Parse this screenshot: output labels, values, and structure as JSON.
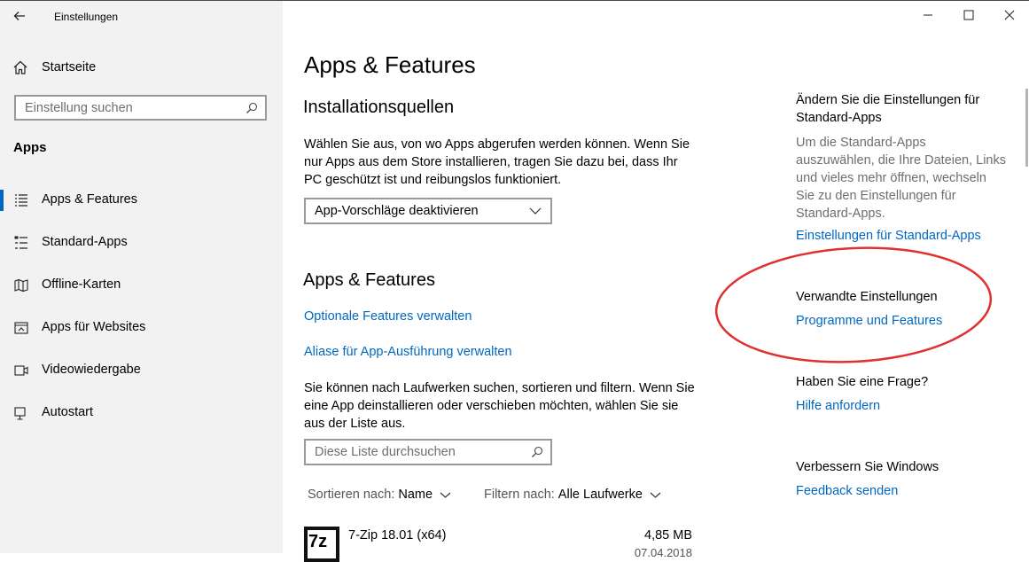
{
  "window": {
    "title": "Einstellungen",
    "back": "back-arrow-icon"
  },
  "sidebar": {
    "home_label": "Startseite",
    "search_placeholder": "Einstellung suchen",
    "section": "Apps",
    "items": [
      {
        "label": "Apps & Features",
        "icon": "apps-features-icon",
        "selected": true
      },
      {
        "label": "Standard-Apps",
        "icon": "default-apps-icon",
        "selected": false
      },
      {
        "label": "Offline-Karten",
        "icon": "offline-maps-icon",
        "selected": false
      },
      {
        "label": "Apps für Websites",
        "icon": "apps-for-websites-icon",
        "selected": false
      },
      {
        "label": "Videowiedergabe",
        "icon": "video-playback-icon",
        "selected": false
      },
      {
        "label": "Autostart",
        "icon": "startup-icon",
        "selected": false
      }
    ]
  },
  "main": {
    "title": "Apps & Features",
    "install_sources": {
      "heading": "Installationsquellen",
      "text": [
        "Wählen Sie aus, von wo Apps abgerufen werden können. Wenn Sie",
        "nur Apps aus dem Store installieren, tragen Sie dazu bei, dass Ihr",
        "PC geschützt ist und reibungslos funktioniert."
      ],
      "dropdown_value": "App-Vorschläge deaktivieren"
    },
    "apps_features": {
      "heading": "Apps & Features",
      "link_optional": "Optionale Features verwalten",
      "link_aliases": "Aliase für App-Ausführung verwalten",
      "text": [
        "Sie können nach Laufwerken suchen, sortieren und filtern. Wenn Sie",
        "eine App deinstallieren oder verschieben möchten, wählen Sie sie",
        "aus der Liste aus."
      ],
      "search_placeholder": "Diese Liste durchsuchen",
      "sort_label": "Sortieren nach:",
      "sort_value": "Name",
      "filter_label": "Filtern nach:",
      "filter_value": "Alle Laufwerke"
    },
    "app_list": [
      {
        "name": "7-Zip 18.01 (x64)",
        "size": "4,85 MB",
        "date": "07.04.2018",
        "icon_text": "7z"
      }
    ]
  },
  "related": {
    "default_apps": {
      "heading": [
        "Ändern Sie die Einstellungen für",
        "Standard-Apps"
      ],
      "text": [
        "Um die Standard-Apps",
        "auszuwählen, die Ihre Dateien, Links",
        "und vieles mehr öffnen, wechseln",
        "Sie zu den Einstellungen für",
        "Standard-Apps."
      ],
      "link": "Einstellungen für Standard-Apps"
    },
    "related_settings": {
      "heading": "Verwandte Einstellungen",
      "link": "Programme und Features"
    },
    "question": {
      "heading": "Haben Sie eine Frage?",
      "link": "Hilfe anfordern"
    },
    "improve": {
      "heading": "Verbessern Sie Windows",
      "link": "Feedback senden"
    }
  },
  "colors": {
    "accent": "#0067c0",
    "sidebar_bg": "#f2f2f2",
    "annotation": "#e03030"
  }
}
